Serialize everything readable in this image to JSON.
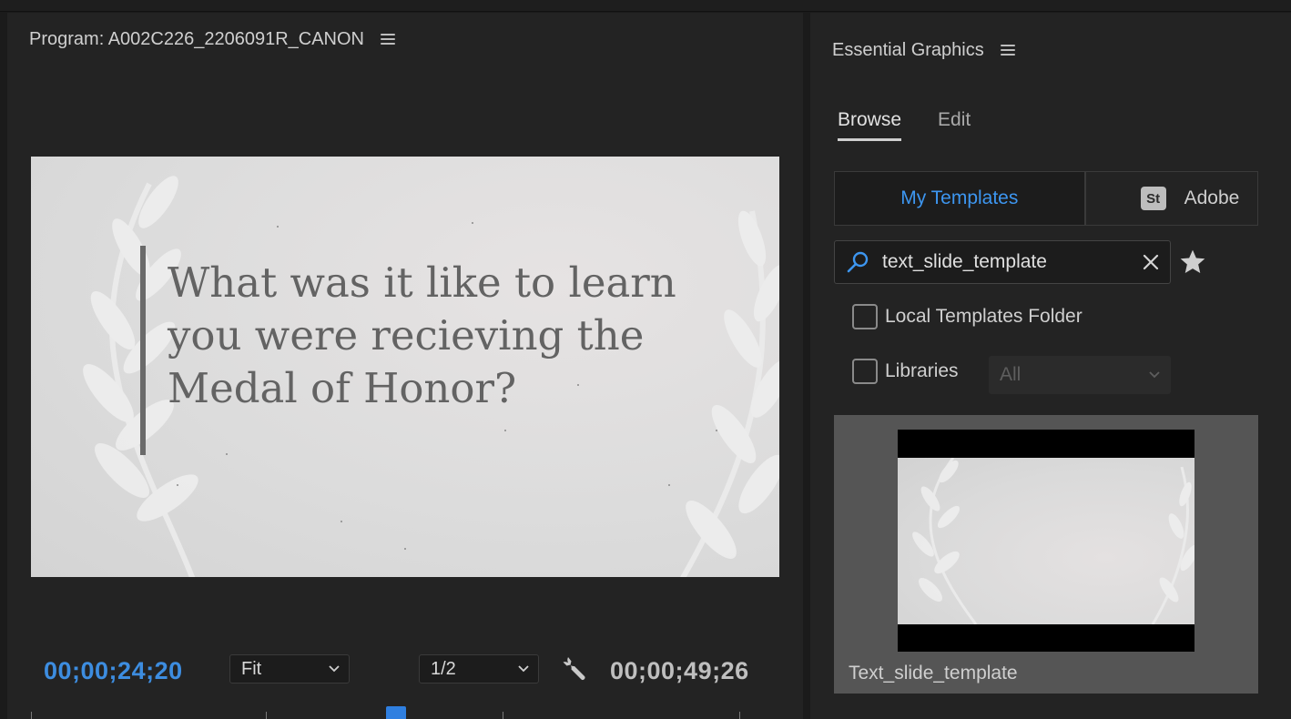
{
  "program": {
    "title": "Program: A002C226_2206091R_CANON",
    "frame_text": "What was it like to learn you were recieving the Medal of Honor?",
    "timecode_current": "00;00;24;20",
    "zoom": "Fit",
    "resolution": "1/2",
    "timecode_duration": "00;00;49;26",
    "playhead_position": 0.5
  },
  "essential_graphics": {
    "title": "Essential Graphics",
    "tabs": [
      {
        "label": "Browse",
        "active": true
      },
      {
        "label": "Edit",
        "active": false
      }
    ],
    "sources": {
      "my_templates": "My Templates",
      "stock_badge": "St",
      "stock_label": "Adobe"
    },
    "search": {
      "value": "text_slide_template"
    },
    "local_templates_label": "Local Templates Folder",
    "libraries_label": "Libraries",
    "libraries_select": "All",
    "template_name": "Text_slide_template"
  },
  "icons": [
    "hamburger-menu-icon",
    "search-icon",
    "clear-icon",
    "star-icon",
    "wrench-icon",
    "chevron-down-icon"
  ],
  "colors": {
    "accent_blue": "#3d8de0",
    "panel_bg": "#232323",
    "frame_text": "#636363"
  }
}
